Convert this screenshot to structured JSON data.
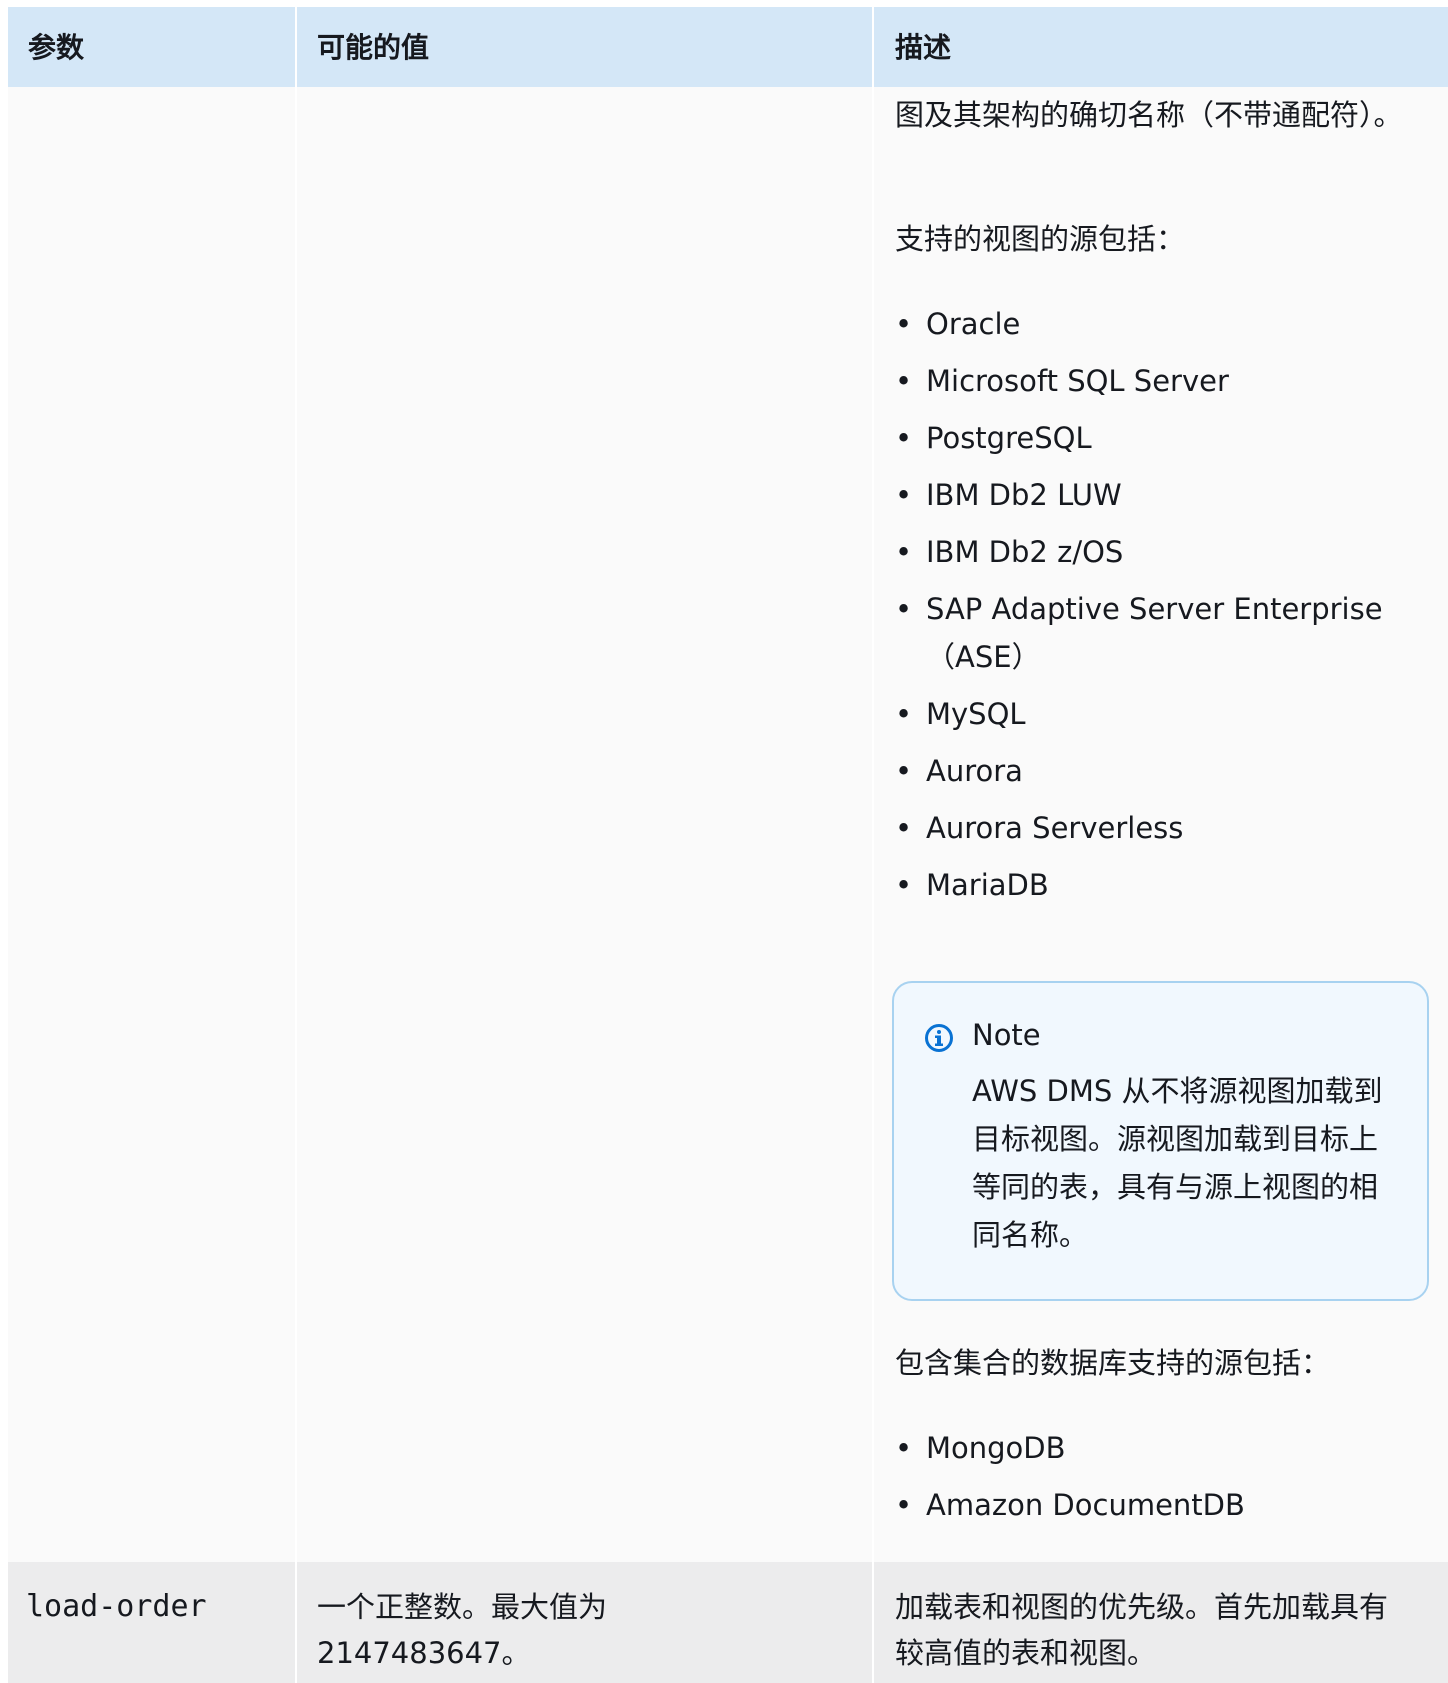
{
  "table": {
    "headers": {
      "param": "参数",
      "values": "可能的值",
      "description": "描述"
    },
    "row1": {
      "description": {
        "intro": "图及其架构的确切名称（不带通配符）。",
        "views_heading": "支持的视图的源包括：",
        "view_sources": [
          "Oracle",
          "Microsoft SQL Server",
          "PostgreSQL",
          "IBM Db2 LUW",
          "IBM Db2 z/OS",
          "SAP Adaptive Server Enterprise（ASE）",
          "MySQL",
          "Aurora",
          "Aurora Serverless",
          "MariaDB"
        ],
        "note": {
          "title": "Note",
          "body": "AWS DMS 从不将源视图加载到目标视图。源视图加载到目标上等同的表，具有与源上视图的相同名称。",
          "icon": "info-icon",
          "accent_color": "#0972d3"
        },
        "collections_heading": "包含集合的数据库支持的源包括：",
        "collection_sources": [
          "MongoDB",
          "Amazon DocumentDB"
        ]
      }
    },
    "row2": {
      "param": "load-order",
      "values": "一个正整数。最大值为 2147483647。",
      "description": "加载表和视图的优先级。首先加载具有较高值的表和视图。"
    }
  }
}
